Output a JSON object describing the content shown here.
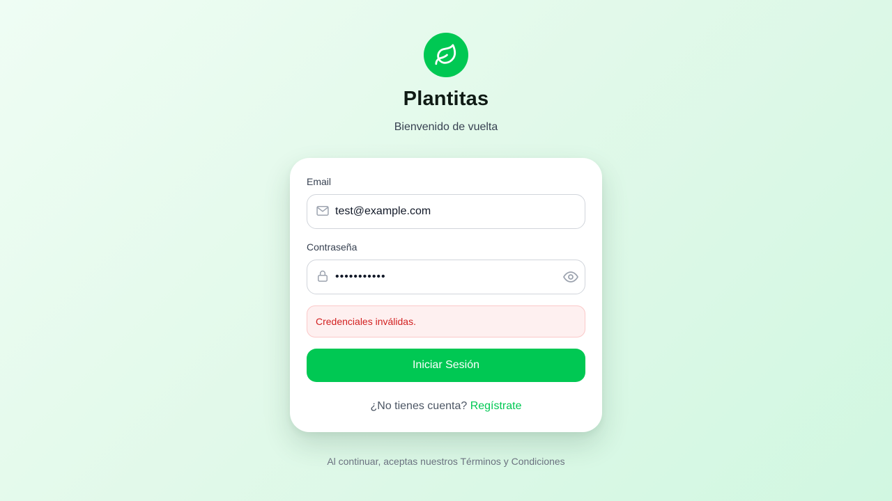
{
  "brand": {
    "icon": "leaf-icon",
    "title": "Plantitas",
    "subtitle": "Bienvenido de vuelta",
    "accent_color": "#00c853"
  },
  "form": {
    "email": {
      "label": "Email",
      "icon": "mail-icon",
      "value": "test@example.com"
    },
    "password": {
      "label": "Contraseña",
      "icon": "lock-icon",
      "value": "•••••••••••",
      "toggle_icon": "eye-icon"
    },
    "error_message": "Credenciales inválidas.",
    "error_color": "#d21f1f",
    "submit_label": "Iniciar Sesión"
  },
  "register": {
    "prompt": "¿No tienes cuenta?",
    "link_label": "Regístrate"
  },
  "footer": {
    "terms": "Al continuar, aceptas nuestros Términos y Condiciones"
  }
}
